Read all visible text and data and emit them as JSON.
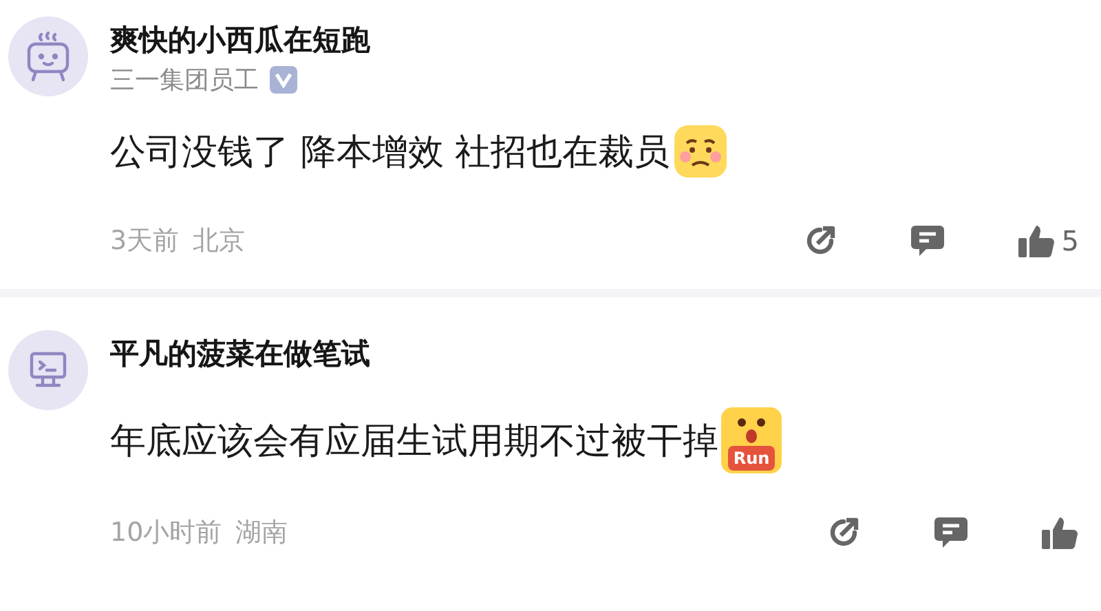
{
  "comments": [
    {
      "author": "爽快的小西瓜在短跑",
      "avatar": {
        "kind": "cup"
      },
      "badge": {
        "text": "三一集团员工",
        "verified": true
      },
      "body": "公司没钱了 降本增效 社招也在裁员",
      "emoji": {
        "kind": "worried"
      },
      "time": "3天前",
      "location": "北京",
      "likes": "5"
    },
    {
      "author": "平凡的菠菜在做笔试",
      "avatar": {
        "kind": "terminal"
      },
      "body": "年底应该会有应届生试用期不过被干掉",
      "emoji": {
        "kind": "run",
        "label": "Run"
      },
      "time": "10小时前",
      "location": "湖南"
    }
  ]
}
